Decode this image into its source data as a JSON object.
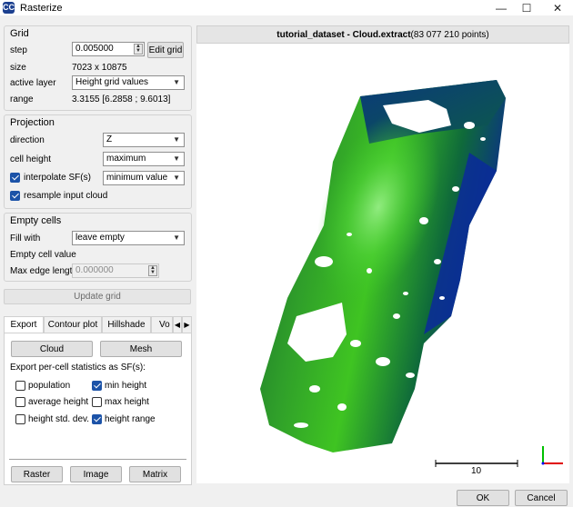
{
  "window": {
    "title": "Rasterize",
    "app_icon_text": "CC",
    "minimize": "—",
    "maximize": "☐",
    "close": "✕"
  },
  "grid": {
    "title": "Grid",
    "step_label": "step",
    "step_value": "0.005000",
    "edit_grid": "Edit grid",
    "size_label": "size",
    "size_value": "7023 x 10875",
    "active_layer_label": "active layer",
    "active_layer_value": "Height grid values",
    "range_label": "range",
    "range_value": "3.3155 [6.2858 ; 9.6013]"
  },
  "projection": {
    "title": "Projection",
    "direction_label": "direction",
    "direction_value": "Z",
    "cell_height_label": "cell height",
    "cell_height_value": "maximum",
    "interpolate_label": "interpolate SF(s)",
    "interpolate_checked": true,
    "interpolate_value": "minimum value",
    "resample_label": "resample input cloud",
    "resample_checked": true
  },
  "empty_cells": {
    "title": "Empty cells",
    "fill_with_label": "Fill with",
    "fill_with_value": "leave empty",
    "empty_value_label": "Empty cell value",
    "max_edge_label": "Max edge length",
    "max_edge_value": "0.000000"
  },
  "update_grid": "Update grid",
  "tabs": [
    {
      "label": "Export"
    },
    {
      "label": "Contour plot"
    },
    {
      "label": "Hillshade"
    },
    {
      "label": "Vo"
    }
  ],
  "export": {
    "cloud": "Cloud",
    "mesh": "Mesh",
    "stats_label": "Export per-cell statistics as SF(s):",
    "stats": [
      {
        "label": "population",
        "checked": false
      },
      {
        "label": "min height",
        "checked": true
      },
      {
        "label": "average height",
        "checked": false
      },
      {
        "label": "max height",
        "checked": false
      },
      {
        "label": "height std. dev.",
        "checked": false
      },
      {
        "label": "height range",
        "checked": true
      }
    ],
    "raster": "Raster",
    "image": "Image",
    "matrix": "Matrix"
  },
  "view": {
    "title_bold": "tutorial_dataset - Cloud.extract",
    "title_points": " (83 077 210 points)",
    "scale_label": "10"
  },
  "dialog": {
    "ok": "OK",
    "cancel": "Cancel"
  },
  "colors": {
    "cloud_dark": "#0a2a8a",
    "cloud_green": "#3bd41f",
    "checkbox_on": "#1c53a8"
  }
}
